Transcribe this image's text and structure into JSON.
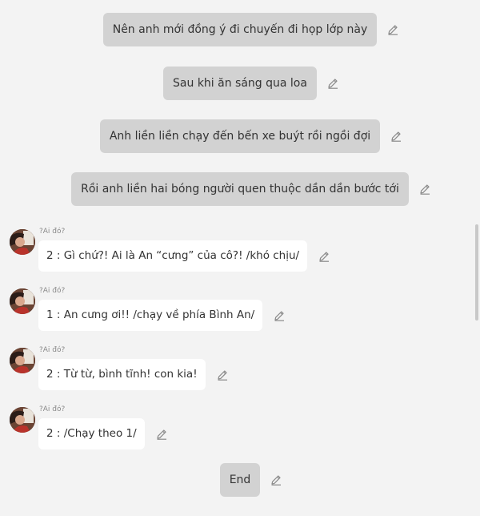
{
  "narration": [
    {
      "text": "Nên anh mới đồng ý đi chuyến đi họp lớp này"
    },
    {
      "text": "Sau khi ăn sáng qua loa"
    },
    {
      "text": "Anh liền liền chạy đến bến xe buýt rồi ngồi đợi"
    },
    {
      "text": "Rồi anh liền hai bóng người quen thuộc dần dần bước tới"
    }
  ],
  "dialogue": [
    {
      "speaker": "?Ai đó?",
      "text": "2 : Gì chứ?! Ai là An “cưng” của cô?! /khó chịu/"
    },
    {
      "speaker": "?Ai đó?",
      "text": "1 : An cưng ơi!! /chạy về phía Bình An/"
    },
    {
      "speaker": "?Ai đó?",
      "text": "2 : Từ từ, bình tĩnh! con kia!"
    },
    {
      "speaker": "?Ai đó?",
      "text": "2 : /Chạy theo 1/"
    }
  ],
  "end": {
    "label": "End"
  },
  "icons": {
    "edit": "pencil-edit-icon",
    "avatar": "character-avatar"
  },
  "colors": {
    "background": "#f3f3f3",
    "narration_bubble": "#d2d2d2",
    "dialogue_bubble": "#ffffff",
    "text": "#333333",
    "speaker": "#8a8a8a",
    "icon": "#8a8a8a"
  }
}
